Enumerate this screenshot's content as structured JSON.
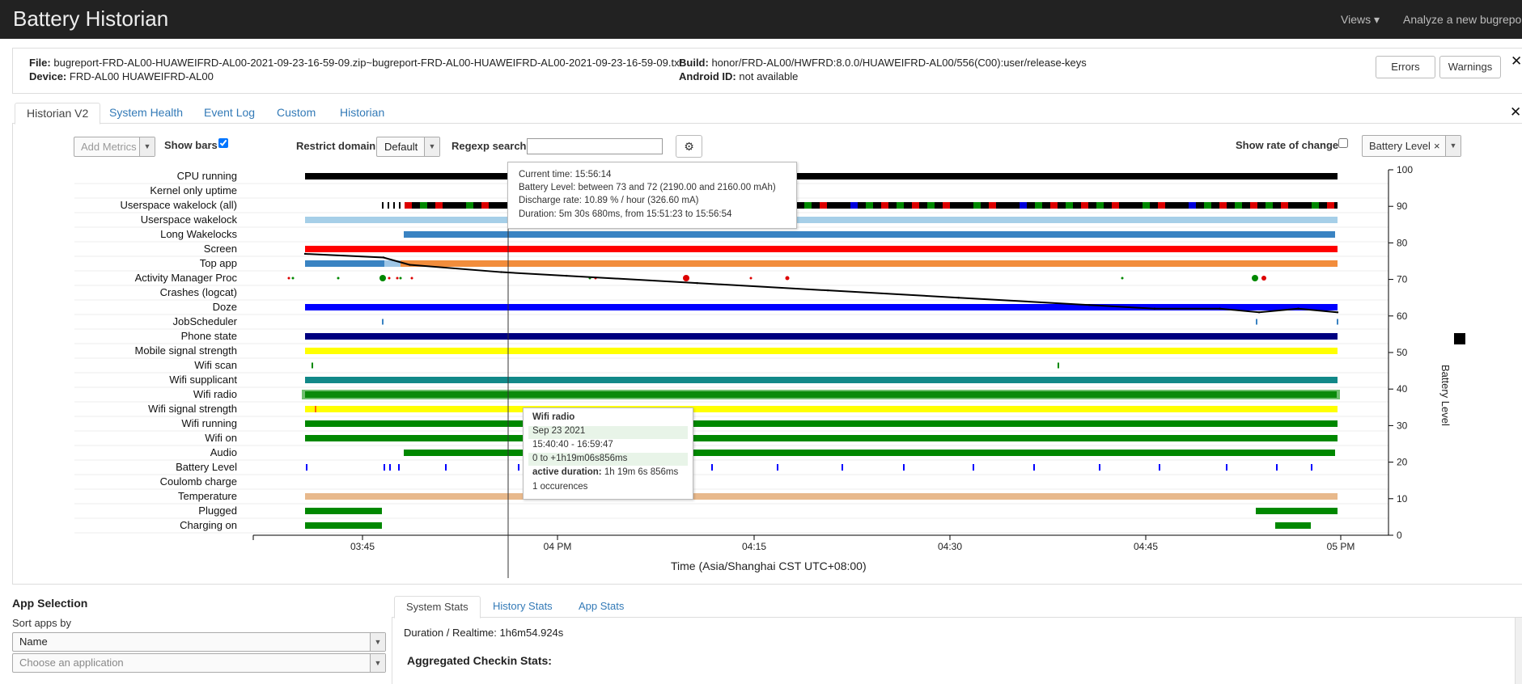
{
  "app": {
    "title": "Battery Historian"
  },
  "navbar": {
    "views": "Views ▾",
    "analyze": "Analyze a new bugreport"
  },
  "info": {
    "file_label": "File:",
    "file_value": "bugreport-FRD-AL00-HUAWEIFRD-AL00-2021-09-23-16-59-09.zip~bugreport-FRD-AL00-HUAWEIFRD-AL00-2021-09-23-16-59-09.txt",
    "device_label": "Device:",
    "device_value": "FRD-AL00 HUAWEIFRD-AL00",
    "build_label": "Build:",
    "build_value": "honor/FRD-AL00/HWFRD:8.0.0/HUAWEIFRD-AL00/556(C00):user/release-keys",
    "android_id_label": "Android ID:",
    "android_id_value": "not available",
    "errors_button": "Errors",
    "warnings_button": "Warnings"
  },
  "tabs": [
    {
      "label": "Historian V2",
      "active": true
    },
    {
      "label": "System Health"
    },
    {
      "label": "Event Log"
    },
    {
      "label": "Custom"
    },
    {
      "label": "Historian"
    }
  ],
  "controls": {
    "add_metrics": "Add Metrics",
    "show_bars": "Show bars",
    "show_bars_checked": true,
    "restrict_domain": "Restrict domain",
    "domain_value": "Default",
    "regexp_search": "Regexp search",
    "regexp_value": "",
    "show_rate_of_change": "Show rate of change",
    "rate_checked": false,
    "metric_select": "Battery Level",
    "metric_clear": "×"
  },
  "rows": [
    "CPU running",
    "Kernel only uptime",
    "Userspace wakelock (all)",
    "Userspace wakelock",
    "Long Wakelocks",
    "Screen",
    "Top app",
    "Activity Manager Proc",
    "Crashes (logcat)",
    "Doze",
    "JobScheduler",
    "Phone state",
    "Mobile signal strength",
    "Wifi scan",
    "Wifi supplicant",
    "Wifi radio",
    "Wifi signal strength",
    "Wifi running",
    "Wifi on",
    "Audio",
    "Battery Level",
    "Coulomb charge",
    "Temperature",
    "Plugged",
    "Charging on"
  ],
  "chart_data": {
    "type": "line",
    "title": "",
    "xlabel": "Time (Asia/Shanghai CST UTC+08:00)",
    "ylabel": "Battery Level",
    "x_ticks": [
      "03:45",
      "04 PM",
      "04:15",
      "04:30",
      "04:45",
      "05 PM"
    ],
    "y_ticks": [
      0,
      10,
      20,
      30,
      40,
      50,
      60,
      70,
      80,
      90,
      100
    ],
    "ylim": [
      0,
      100
    ],
    "xlim": [
      "15:40",
      "16:59"
    ],
    "series": [
      {
        "name": "Battery Level",
        "x": [
          "15:40",
          "15:46",
          "15:48",
          "15:55",
          "16:00",
          "16:10",
          "16:20",
          "16:30",
          "16:40",
          "16:45",
          "16:50",
          "16:53",
          "16:56",
          "16:59"
        ],
        "values": [
          77,
          76,
          74,
          72,
          71,
          69,
          67,
          65,
          63,
          62,
          62,
          61,
          62,
          61
        ]
      }
    ]
  },
  "tooltip_battery": {
    "line1": "Current time: 15:56:14",
    "line2": "Battery Level: between 73 and 72 (2190.00 and 2160.00 mAh)",
    "line3": "Discharge rate: 10.89 % / hour (326.60 mA)",
    "line4": "Duration: 5m 30s 680ms, from 15:51:23 to 15:56:54"
  },
  "tooltip_wifi": {
    "title": "Wifi radio",
    "date": "Sep 23 2021",
    "range": "15:40:40 - 16:59:47",
    "offset": "0 to +1h19m06s856ms",
    "active_label": "active duration:",
    "active_value": "1h 19m 6s 856ms",
    "occurrences": "1 occurences"
  },
  "app_selection": {
    "title": "App Selection",
    "sort_label": "Sort apps by",
    "sort_value": "Name",
    "choose_placeholder": "Choose an application"
  },
  "stats": {
    "tabs": [
      "System Stats",
      "History Stats",
      "App Stats"
    ],
    "duration": "Duration / Realtime: 1h6m54.924s",
    "aggregated": "Aggregated Checkin Stats:"
  },
  "colors": {
    "navbar": "#222222",
    "link": "#337ab7",
    "battery_line": "#000000"
  }
}
